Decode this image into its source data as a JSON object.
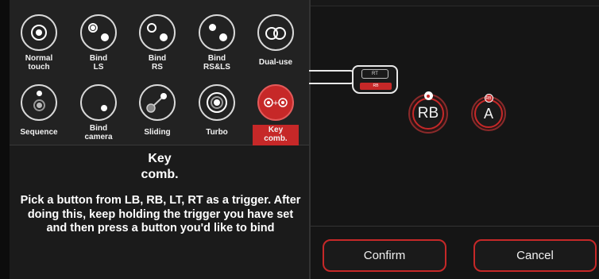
{
  "modes": [
    {
      "label_lines": [
        "Normal",
        "touch"
      ],
      "icon": "normal-touch-icon"
    },
    {
      "label_lines": [
        "Bind",
        "LS"
      ],
      "icon": "bind-ls-icon"
    },
    {
      "label_lines": [
        "Bind",
        "RS"
      ],
      "icon": "bind-rs-icon"
    },
    {
      "label_lines": [
        "Bind",
        "RS&LS"
      ],
      "icon": "bind-rs-ls-icon"
    },
    {
      "label_lines": [
        "Dual-use"
      ],
      "icon": "dual-use-icon"
    },
    {
      "label_lines": [
        "Sequence"
      ],
      "icon": "sequence-icon"
    },
    {
      "label_lines": [
        "Bind",
        "camera"
      ],
      "icon": "bind-camera-icon"
    },
    {
      "label_lines": [
        "Sliding"
      ],
      "icon": "sliding-icon"
    },
    {
      "label_lines": [
        "Turbo"
      ],
      "icon": "turbo-icon"
    },
    {
      "label_lines": [
        "Key",
        "comb."
      ],
      "icon": "key-comb-icon",
      "selected": true
    }
  ],
  "description": {
    "title_line1": "Key",
    "title_line2": "comb.",
    "text": "Pick a button from LB, RB, LT, RT as a trigger. After doing this, keep holding the trigger you have set and then press a button you'd like to bind"
  },
  "controller": {
    "rt_label": "RT",
    "rb_label": "RB"
  },
  "preview_buttons": {
    "trigger": "RB",
    "bound": "A",
    "bound_badge": "RB"
  },
  "actions": {
    "confirm": "Confirm",
    "cancel": "Cancel"
  },
  "colors": {
    "accent": "#c62828",
    "panel": "#1b1b1b",
    "background": "#151515"
  }
}
